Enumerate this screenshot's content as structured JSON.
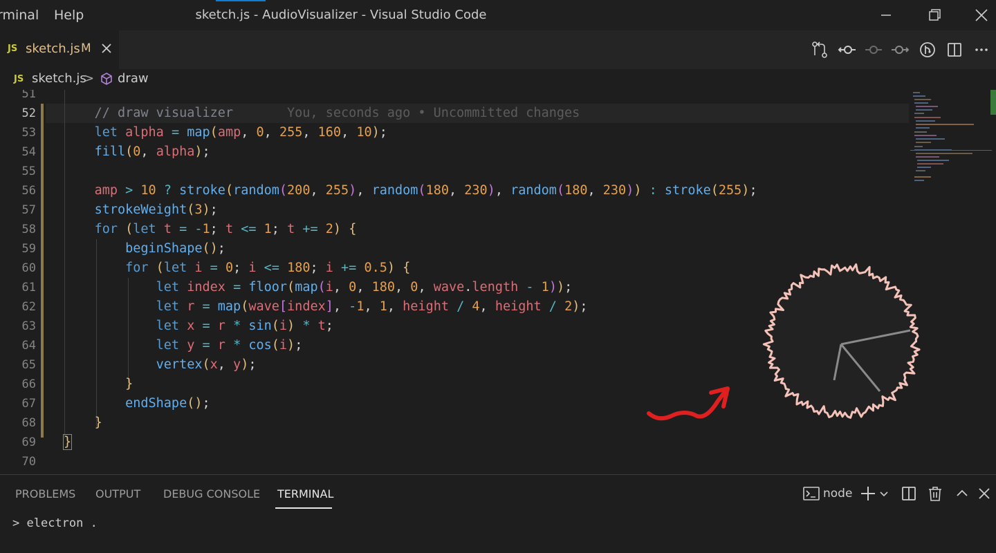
{
  "titlebar": {
    "menu_terminal": "rminal",
    "menu_help": "Help",
    "title": "sketch.js - AudioVisualizer - Visual Studio Code"
  },
  "tab": {
    "badge": "JS",
    "label": "sketch.js",
    "modified": "M"
  },
  "breadcrumb": {
    "badge": "JS",
    "file": "sketch.js",
    "separator": ">",
    "symbol": "draw"
  },
  "editor": {
    "active_line": 52,
    "blame": "You, seconds ago • Uncommitted changes",
    "line_numbers": [
      "51",
      "52",
      "53",
      "54",
      "55",
      "56",
      "57",
      "58",
      "59",
      "60",
      "61",
      "62",
      "63",
      "64",
      "65",
      "66",
      "67",
      "68",
      "69",
      "70"
    ],
    "lines": [
      "",
      "    // draw visualizer",
      "    let alpha = map(amp, 0, 255, 160, 10);",
      "    fill(0, alpha);",
      "",
      "    amp > 10 ? stroke(random(200, 255), random(180, 230), random(180, 230)) : stroke(255);",
      "    strokeWeight(3);",
      "    for (let t = -1; t <= 1; t += 2) {",
      "        beginShape();",
      "        for (let i = 0; i <= 180; i += 0.5) {",
      "            let index = floor(map(i, 0, 180, 0, wave.length - 1));",
      "            let r = map(wave[index], -1, 1, height / 4, height / 2);",
      "            let x = r * sin(i) * t;",
      "            let y = r * cos(i);",
      "            vertex(x, y);",
      "        }",
      "        endShape();",
      "    }",
      "}",
      ""
    ]
  },
  "panel": {
    "tabs": [
      "PROBLEMS",
      "OUTPUT",
      "DEBUG CONSOLE",
      "TERMINAL"
    ],
    "active_tab": "TERMINAL",
    "terminal_shell": "node",
    "terminal_prompt": ">",
    "terminal_command": "electron ."
  },
  "colors": {
    "accent": "#0e7fd4",
    "visualizer_stroke": "#f4c2b8",
    "annotation": "#e02020"
  }
}
